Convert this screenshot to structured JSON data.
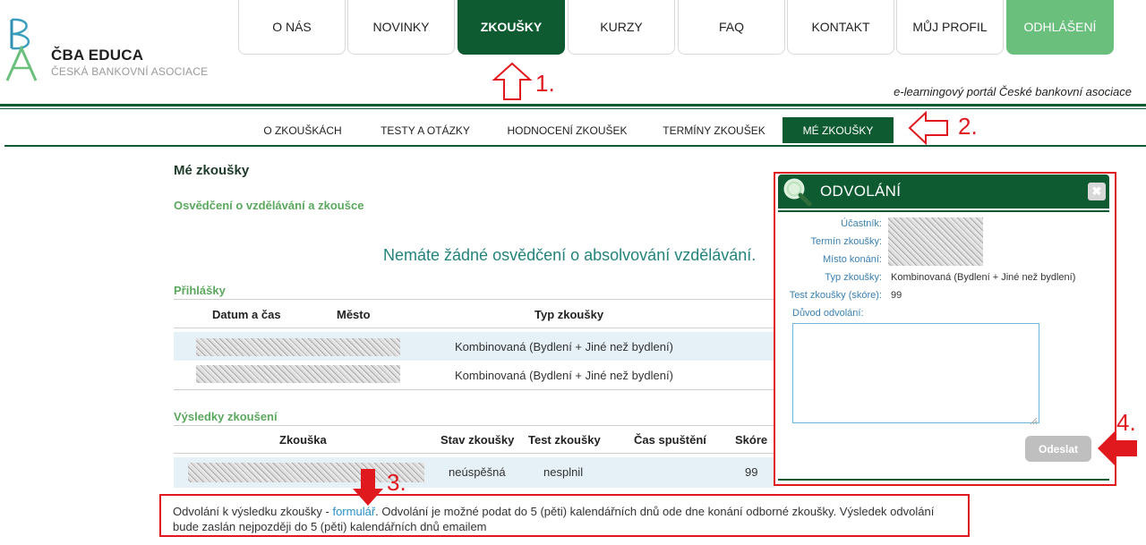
{
  "logo": {
    "name": "ČBA EDUCA",
    "subtitle": "ČESKÁ BANKOVNÍ ASOCIACE"
  },
  "nav": {
    "items": [
      {
        "label": "O NÁS"
      },
      {
        "label": "NOVINKY"
      },
      {
        "label": "ZKOUŠKY"
      },
      {
        "label": "KURZY"
      },
      {
        "label": "FAQ"
      },
      {
        "label": "KONTAKT"
      },
      {
        "label": "MŮJ PROFIL"
      },
      {
        "label": "ODHLÁŠENÍ"
      }
    ],
    "active": "ZKOUŠKY"
  },
  "tagline": "e-learningový portál České bankovní asociace",
  "subnav": {
    "items": [
      {
        "label": "O ZKOUŠKÁCH"
      },
      {
        "label": "TESTY A OTÁZKY"
      },
      {
        "label": "HODNOCENÍ ZKOUŠEK"
      },
      {
        "label": "TERMÍNY ZKOUŠEK"
      },
      {
        "label": "MÉ ZKOUŠKY"
      }
    ],
    "active": "MÉ ZKOUŠKY"
  },
  "main": {
    "title": "Mé zkoušky",
    "certificates": {
      "title": "Osvědčení o vzdělávání a zkoušce",
      "empty_message": "Nemáte žádné osvědčení o absolvování vzdělávání."
    },
    "applications": {
      "title": "Přihlášky",
      "headers": [
        "Datum a čas",
        "Město",
        "Typ zkoušky"
      ],
      "rows": [
        {
          "type": "Kombinovaná (Bydlení + Jiné než bydlení)"
        },
        {
          "type": "Kombinovaná (Bydlení + Jiné než bydlení)"
        }
      ]
    },
    "results": {
      "title": "Výsledky zkoušení",
      "headers": [
        "Zkouška",
        "Stav zkoušky",
        "Test zkoušky",
        "Čas spuštění",
        "Skóre"
      ],
      "rows": [
        {
          "status": "neúspěšná",
          "test": "nesplnil",
          "score": "99"
        }
      ]
    }
  },
  "appeal_info": {
    "prefix": "Odvolání k výsledku zkoušky - ",
    "link": "formulář",
    "suffix": ". Odvolání je možné podat do 5 (pěti) kalendářních dnů ode dne konání odborné zkoušky. Výsledek odvolání bude zaslán nejpozději do 5 (pěti) kalendářních dnů emailem"
  },
  "modal": {
    "title": "ODVOLÁNÍ",
    "close": "✖",
    "labels": {
      "participant": "Účastník:",
      "exam_date": "Termín zkoušky:",
      "place": "Místo konání:",
      "exam_type": "Typ zkoušky:",
      "test": "Test zkoušky (skóre):",
      "reason": "Důvod odvolání:"
    },
    "values": {
      "exam_type": "Kombinovaná (Bydlení + Jiné než bydlení)",
      "test": "99"
    },
    "reason_value": "",
    "submit": "Odeslat"
  },
  "callouts": [
    "1.",
    "2.",
    "3.",
    "4."
  ],
  "colors": {
    "brand_dark": "#0e5a31",
    "brand_light": "#6bbf7d",
    "annotation_red": "#e0191e",
    "link": "#2b8fc6"
  }
}
